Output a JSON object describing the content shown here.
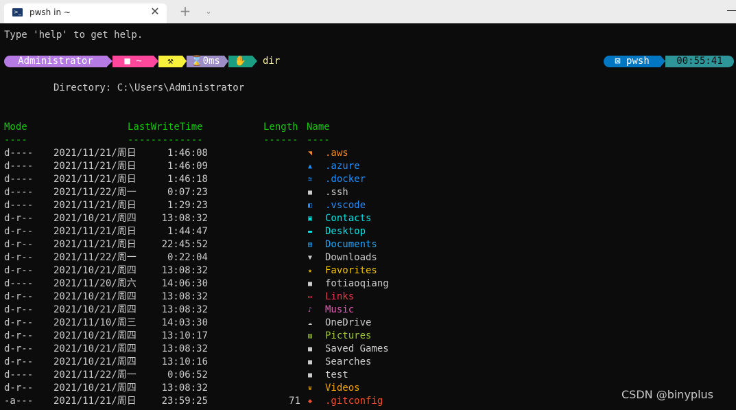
{
  "titlebar": {
    "tab_title": "pwsh in ~",
    "tab_icon": "powershell-icon",
    "close_glyph": "✕",
    "new_tab_glyph": "+",
    "dropdown_glyph": "⌄"
  },
  "terminal": {
    "welcome": "Type 'help' to get help.",
    "prompt": {
      "user": "Administrator",
      "folder": "■ ~",
      "git": "⚒",
      "exec_time": "⌛0ms",
      "status": "✋",
      "command": "dir"
    },
    "right_prompt": {
      "shell": "⊠ pwsh",
      "time": "00:55:41"
    },
    "directory_line": "Directory: C:\\Users\\Administrator",
    "headers": {
      "mode": "Mode",
      "time": "LastWriteTime",
      "length": "Length",
      "name": "Name"
    },
    "separators": {
      "mode": "----",
      "time": "-------------",
      "length": "------",
      "name": "----"
    },
    "entries": [
      {
        "mode": "d----",
        "date": "2021/11/21/周日",
        "time": "1:46:08",
        "length": "",
        "name": ".aws",
        "icon": "aws-icon",
        "color": "#f28c28"
      },
      {
        "mode": "d----",
        "date": "2021/11/21/周日",
        "time": "1:46:09",
        "length": "",
        "name": ".azure",
        "icon": "azure-icon",
        "color": "#1e90ff"
      },
      {
        "mode": "d----",
        "date": "2021/11/21/周日",
        "time": "1:46:18",
        "length": "",
        "name": ".docker",
        "icon": "docker-icon",
        "color": "#1e90ff"
      },
      {
        "mode": "d----",
        "date": "2021/11/22/周一",
        "time": "0:07:23",
        "length": "",
        "name": ".ssh",
        "icon": "folder-icon",
        "color": "#cccccc"
      },
      {
        "mode": "d----",
        "date": "2021/11/21/周日",
        "time": "1:29:23",
        "length": "",
        "name": ".vscode",
        "icon": "vscode-icon",
        "color": "#1e90ff"
      },
      {
        "mode": "d-r--",
        "date": "2021/10/21/周四",
        "time": "13:08:32",
        "length": "",
        "name": "Contacts",
        "icon": "contacts-icon",
        "color": "#00e5e5"
      },
      {
        "mode": "d-r--",
        "date": "2021/11/21/周日",
        "time": "1:44:47",
        "length": "",
        "name": "Desktop",
        "icon": "desktop-icon",
        "color": "#00e5e5"
      },
      {
        "mode": "d-r--",
        "date": "2021/11/21/周日",
        "time": "22:45:52",
        "length": "",
        "name": "Documents",
        "icon": "documents-icon",
        "color": "#1ea5ff"
      },
      {
        "mode": "d-r--",
        "date": "2021/11/22/周一",
        "time": "0:22:04",
        "length": "",
        "name": "Downloads",
        "icon": "downloads-icon",
        "color": "#cccccc"
      },
      {
        "mode": "d-r--",
        "date": "2021/10/21/周四",
        "time": "13:08:32",
        "length": "",
        "name": "Favorites",
        "icon": "favorites-icon",
        "color": "#f2c500"
      },
      {
        "mode": "d----",
        "date": "2021/11/20/周六",
        "time": "14:06:30",
        "length": "",
        "name": "fotiaoqiang",
        "icon": "folder-icon",
        "color": "#cccccc"
      },
      {
        "mode": "d-r--",
        "date": "2021/10/21/周四",
        "time": "13:08:32",
        "length": "",
        "name": "Links",
        "icon": "links-icon",
        "color": "#e8374a"
      },
      {
        "mode": "d-r--",
        "date": "2021/10/21/周四",
        "time": "13:08:32",
        "length": "",
        "name": "Music",
        "icon": "music-icon",
        "color": "#e05ab0"
      },
      {
        "mode": "d-r--",
        "date": "2021/11/10/周三",
        "time": "14:03:30",
        "length": "",
        "name": "OneDrive",
        "icon": "onedrive-icon",
        "color": "#cccccc"
      },
      {
        "mode": "d-r--",
        "date": "2021/10/21/周四",
        "time": "13:10:17",
        "length": "",
        "name": "Pictures",
        "icon": "pictures-icon",
        "color": "#9cc43a"
      },
      {
        "mode": "d-r--",
        "date": "2021/10/21/周四",
        "time": "13:08:32",
        "length": "",
        "name": "Saved Games",
        "icon": "folder-icon",
        "color": "#cccccc"
      },
      {
        "mode": "d-r--",
        "date": "2021/10/21/周四",
        "time": "13:10:16",
        "length": "",
        "name": "Searches",
        "icon": "folder-icon",
        "color": "#cccccc"
      },
      {
        "mode": "d----",
        "date": "2021/11/22/周一",
        "time": "0:06:52",
        "length": "",
        "name": "test",
        "icon": "folder-icon",
        "color": "#cccccc"
      },
      {
        "mode": "d-r--",
        "date": "2021/10/21/周四",
        "time": "13:08:32",
        "length": "",
        "name": "Videos",
        "icon": "videos-icon",
        "color": "#f2a500"
      },
      {
        "mode": "-a---",
        "date": "2021/11/21/周日",
        "time": "23:59:25",
        "length": "71",
        "name": ".gitconfig",
        "icon": "git-icon",
        "color": "#f14e32"
      }
    ]
  },
  "watermark": "CSDN @binyplus"
}
